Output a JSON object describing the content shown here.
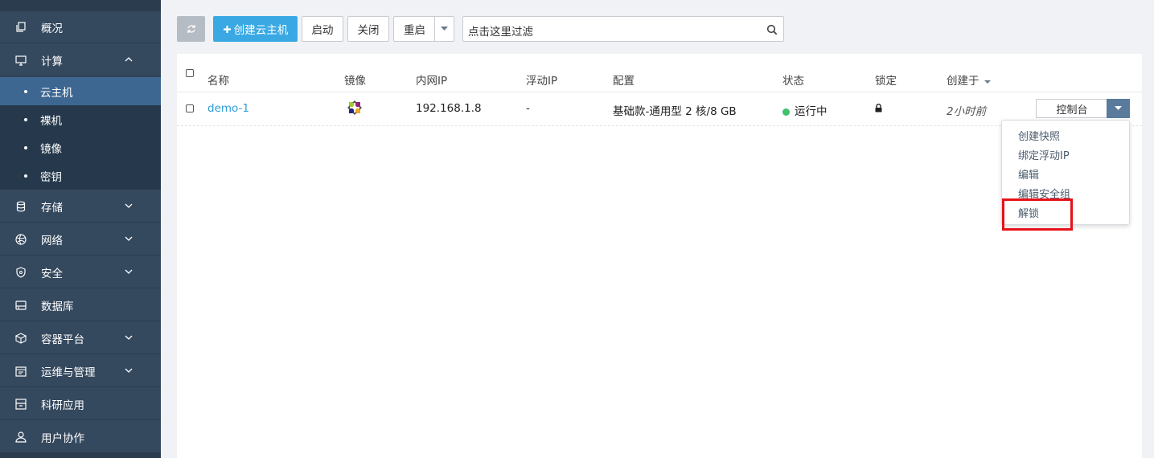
{
  "sidebar": {
    "items": [
      {
        "label": "概况",
        "icon": "copy-icon"
      },
      {
        "label": "计算",
        "icon": "monitor-icon",
        "expanded": true
      },
      {
        "label": "存储",
        "icon": "database-icon"
      },
      {
        "label": "网络",
        "icon": "network-icon"
      },
      {
        "label": "安全",
        "icon": "shield-icon"
      },
      {
        "label": "数据库",
        "icon": "server-icon"
      },
      {
        "label": "容器平台",
        "icon": "cube-icon"
      },
      {
        "label": "运维与管理",
        "icon": "calendar-icon"
      },
      {
        "label": "科研应用",
        "icon": "archive-icon"
      },
      {
        "label": "用户协作",
        "icon": "user-icon"
      }
    ],
    "sub_items": [
      {
        "label": "云主机",
        "active": true
      },
      {
        "label": "裸机"
      },
      {
        "label": "镜像"
      },
      {
        "label": "密钥"
      }
    ]
  },
  "toolbar": {
    "create_label": "创建云主机",
    "start_label": "启动",
    "stop_label": "关闭",
    "reboot_label": "重启",
    "search_placeholder": "点击这里过滤"
  },
  "table": {
    "columns": [
      "名称",
      "镜像",
      "内网IP",
      "浮动IP",
      "配置",
      "状态",
      "锁定",
      "创建于"
    ],
    "rows": [
      {
        "name": "demo-1",
        "ip": "192.168.1.8",
        "floating_ip": "-",
        "config": "基础款-通用型 2 核/8 GB",
        "status": "运行中",
        "created": "2小时前",
        "action": "控制台"
      }
    ]
  },
  "action_menu": {
    "items": [
      "创建快照",
      "绑定浮动IP",
      "编辑",
      "编辑安全组",
      "解锁"
    ]
  },
  "colors": {
    "sidebar_bg": "#34485e",
    "active_sub_bg": "#3d6791",
    "accent": "#3aa9e3",
    "status_running": "#3ec16b",
    "highlight": "#e5121a"
  }
}
